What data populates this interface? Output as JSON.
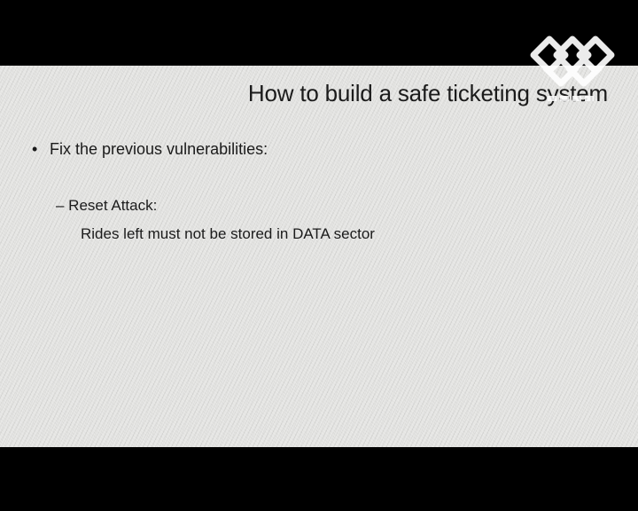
{
  "slide": {
    "title": "How to build a safe ticketing system",
    "bullet_marker": "•",
    "bullet_text": "Fix the previous vulnerabilities:",
    "sub_item": "– Reset Attack:",
    "sub_detail": "Rides left must not be stored in DATA sector"
  },
  "logo": {
    "icon": "diamond-lattice-logo-icon"
  }
}
